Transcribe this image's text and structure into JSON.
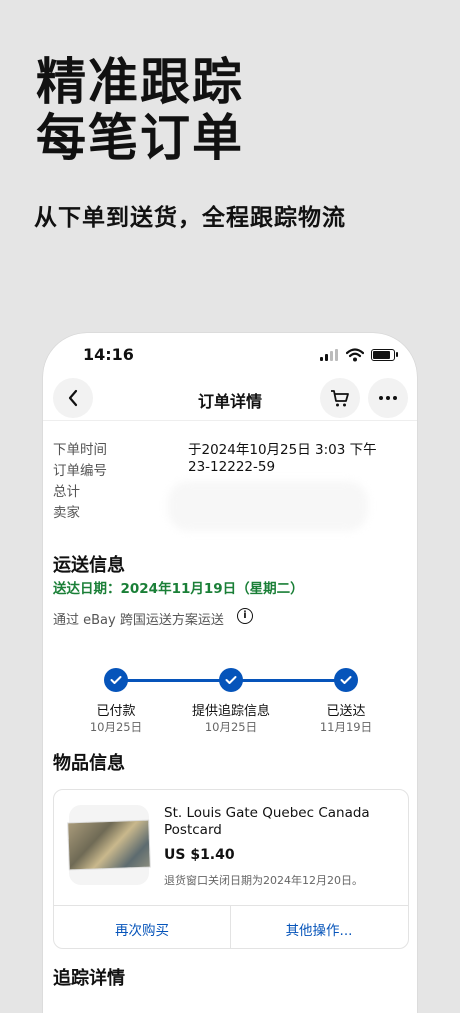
{
  "promo": {
    "title_line1": "精准跟踪",
    "title_line2": "每笔订单",
    "subtitle": "从下单到送货，全程跟踪物流"
  },
  "status_bar": {
    "time": "14:16"
  },
  "header": {
    "title": "订单详情"
  },
  "order_info": {
    "rows": [
      {
        "label": "下单时间",
        "value": "于2024年10月25日 3:03 下午"
      },
      {
        "label": "订单编号",
        "value": "23-12222-59"
      },
      {
        "label": "总计",
        "value": ""
      },
      {
        "label": "卖家",
        "value": ""
      }
    ]
  },
  "shipping": {
    "heading": "运送信息",
    "delivery_date": "送达日期：2024年11月19日（星期二）",
    "via": "通过 eBay 跨国运送方案运送",
    "steps": [
      {
        "label": "已付款",
        "date": "10月25日"
      },
      {
        "label": "提供追踪信息",
        "date": "10月25日"
      },
      {
        "label": "已送达",
        "date": "11月19日"
      }
    ]
  },
  "item_section": {
    "heading": "物品信息",
    "title": "St. Louis Gate Quebec Canada Postcard",
    "price": "US $1.40",
    "return_note": "退货窗口关闭日期为2024年12月20日。",
    "buy_again": "再次购买",
    "more_actions": "其他操作..."
  },
  "tracking": {
    "heading": "追踪详情"
  },
  "colors": {
    "accent": "#0654ba",
    "success": "#1a7f37"
  }
}
